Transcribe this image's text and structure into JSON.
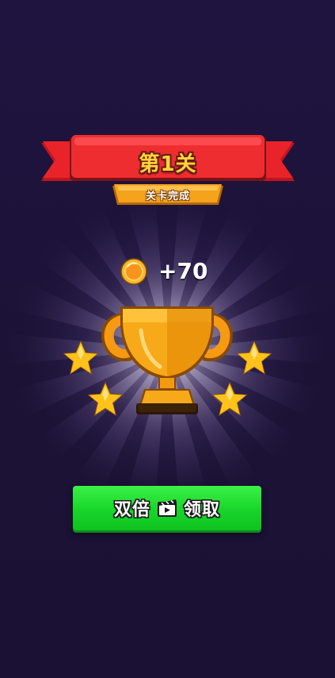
{
  "level_complete": {
    "banner_title": "第1关",
    "banner_subtitle": "关卡完成"
  },
  "reward": {
    "icon": "coin-icon",
    "amount_text": "+70"
  },
  "trophy": {
    "icon": "trophy-icon",
    "stars": [
      "star-icon",
      "star-icon",
      "star-icon",
      "star-icon"
    ]
  },
  "claim_button": {
    "left_label": "双倍",
    "icon": "video-ad-icon",
    "right_label": "领取",
    "color": "#17d52a"
  },
  "colors": {
    "background": "#1e1339",
    "banner_red": "#e8242a",
    "ribbon_orange": "#f5a21c",
    "gold": "#ffb300"
  }
}
